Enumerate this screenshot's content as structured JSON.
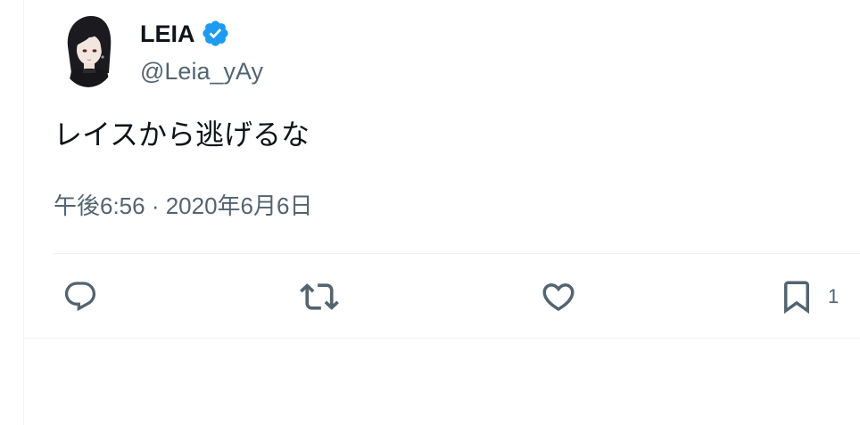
{
  "author": {
    "display_name": "LEIA",
    "handle": "@Leia_yAy",
    "verified": true,
    "verified_color": "#1d9bf0"
  },
  "tweet": {
    "text": "レイスから逃げるな",
    "timestamp": "午後6:56 · 2020年6月6日"
  },
  "actions": {
    "reply": {
      "icon": "reply-icon"
    },
    "retweet": {
      "icon": "retweet-icon"
    },
    "like": {
      "icon": "heart-icon"
    },
    "bookmark": {
      "icon": "bookmark-icon",
      "count": "1"
    }
  },
  "colors": {
    "text_primary": "#0f1419",
    "text_secondary": "#536471",
    "divider": "#eff3f4",
    "icon": "#536471"
  }
}
